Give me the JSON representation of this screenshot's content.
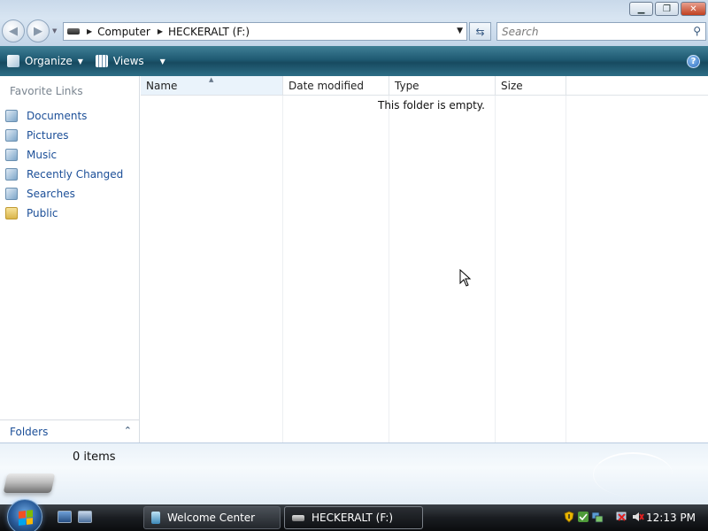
{
  "window": {
    "minimize_icon": "minimize-icon",
    "maximize_icon": "restore-icon",
    "close_icon": "close-icon"
  },
  "address_bar": {
    "crumbs": [
      "Computer",
      "HECKERALT (F:)"
    ]
  },
  "search": {
    "placeholder": "Search"
  },
  "command_bar": {
    "organize_label": "Organize",
    "views_label": "Views",
    "help_label": "?"
  },
  "favorites": {
    "title": "Favorite Links",
    "items": [
      {
        "label": "Documents",
        "icon": "documents-icon"
      },
      {
        "label": "Pictures",
        "icon": "pictures-icon"
      },
      {
        "label": "Music",
        "icon": "music-icon"
      },
      {
        "label": "Recently Changed",
        "icon": "recently-changed-icon"
      },
      {
        "label": "Searches",
        "icon": "searches-icon"
      },
      {
        "label": "Public",
        "icon": "public-folder-icon"
      }
    ],
    "folders_label": "Folders"
  },
  "file_list": {
    "columns": [
      "Name",
      "Date modified",
      "Type",
      "Size"
    ],
    "empty_message": "This folder is empty."
  },
  "details_pane": {
    "item_count": "0 items"
  },
  "taskbar": {
    "buttons": [
      {
        "label": "Welcome Center",
        "active": false
      },
      {
        "label": "HECKERALT (F:)",
        "active": true
      }
    ],
    "clock": "12:13 PM"
  }
}
